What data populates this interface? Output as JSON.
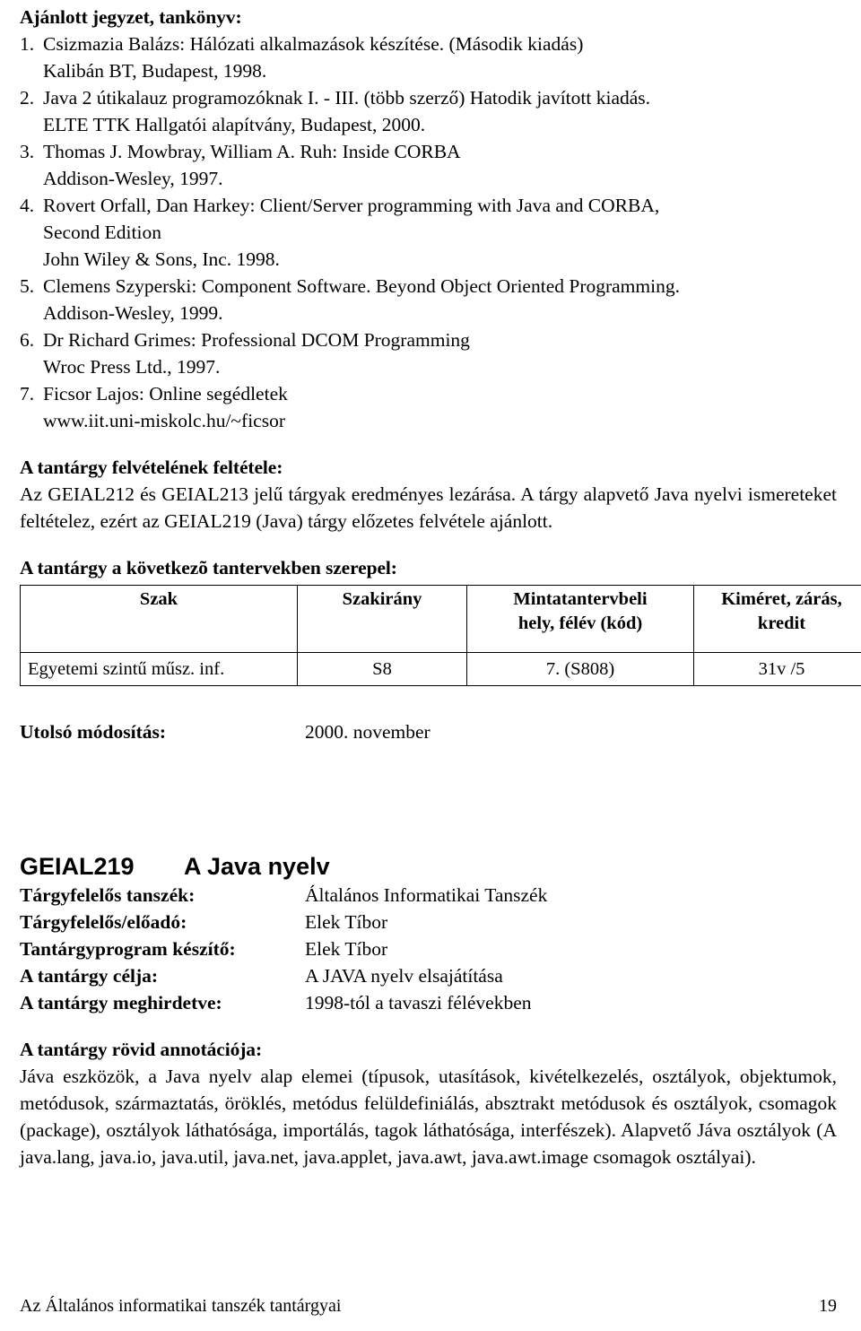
{
  "sections": {
    "biblio_heading": "Ajánlott jegyzet, tankönyv:",
    "bibliography": [
      {
        "num": "1.",
        "lines": [
          "Csizmazia Balázs: Hálózati alkalmazások készítése. (Második kiadás)",
          "Kalibán BT, Budapest, 1998."
        ]
      },
      {
        "num": "2.",
        "lines": [
          "Java 2 útikalauz programozóknak I. - III. (több szerző) Hatodik javított kiadás.",
          "ELTE TTK Hallgatói alapítvány, Budapest, 2000."
        ]
      },
      {
        "num": "3.",
        "lines": [
          "Thomas J. Mowbray, William A. Ruh: Inside CORBA",
          "Addison-Wesley, 1997."
        ]
      },
      {
        "num": "4.",
        "lines": [
          "Rovert Orfall, Dan Harkey: Client/Server programming with Java and CORBA,",
          "Second Edition",
          "John Wiley & Sons, Inc. 1998."
        ]
      },
      {
        "num": "5.",
        "lines": [
          "Clemens Szyperski: Component Software. Beyond Object Oriented Programming.",
          "Addison-Wesley, 1999."
        ]
      },
      {
        "num": "6.",
        "lines": [
          "Dr Richard Grimes: Professional DCOM Programming",
          "Wroc Press Ltd., 1997."
        ]
      },
      {
        "num": "7.",
        "lines": [
          "Ficsor Lajos: Online segédletek",
          "www.iit.uni-miskolc.hu/~ficsor"
        ]
      }
    ],
    "prereq_heading": "A tantárgy felvételének feltétele:",
    "prereq_text": "Az GEIAL212 és GEIAL213 jelű tárgyak eredményes lezárása. A tárgy alapvető Java nyelvi ismereteket feltételez, ezért az GEIAL219 (Java) tárgy előzetes felvétele ajánlott.",
    "curricula_heading": "A tantárgy a következõ tantervekben szerepel:",
    "last_modified_label": "Utolsó módosítás:",
    "last_modified_value": "2000. november"
  },
  "curricula_table": {
    "columns": [
      "Szak",
      "Szakirány",
      "Mintatantervbeli hely, félév (kód)",
      "Kiméret, zárás, kredit"
    ],
    "column_lines": [
      [
        "Szak"
      ],
      [
        "Szakirány"
      ],
      [
        "Mintatantervbeli",
        "hely, félév (kód)"
      ],
      [
        "Kiméret, zárás,",
        "kredit"
      ]
    ],
    "rows": [
      [
        "Egyetemi szintű műsz. inf.",
        "S8",
        "7. (S808)",
        "31v /5"
      ]
    ]
  },
  "course": {
    "code": "GEIAL219",
    "title": "A Java nyelv",
    "meta": [
      {
        "label": "Tárgyfelelős tanszék:",
        "value": "Általános Informatikai Tanszék"
      },
      {
        "label": "Tárgyfelelős/előadó:",
        "value": "Elek Tíbor"
      },
      {
        "label": "Tantárgyprogram készítő:",
        "value": "Elek Tíbor"
      },
      {
        "label": "A tantárgy célja:",
        "value": "A JAVA nyelv elsajátítása"
      },
      {
        "label": "A tantárgy meghirdetve:",
        "value": "1998-tól a tavaszi félévekben"
      }
    ],
    "annotation_heading": "A tantárgy rövid annotációja:",
    "annotation_text": "Jáva eszközök, a Java nyelv alap elemei (típusok, utasítások, kivételkezelés, osztályok, objektumok, metódusok, származtatás, öröklés, metódus felüldefiniálás, absztrakt metódusok és osztályok, csomagok (package), osztályok láthatósága, importálás, tagok láthatósága, interfészek). Alapvető Jáva osztályok (A java.lang, java.io, java.util, java.net, java.applet, java.awt, java.awt.image csomagok osztályai)."
  },
  "footer": {
    "text": "Az Általános informatikai tanszék tantárgyai",
    "page_number": "19"
  }
}
